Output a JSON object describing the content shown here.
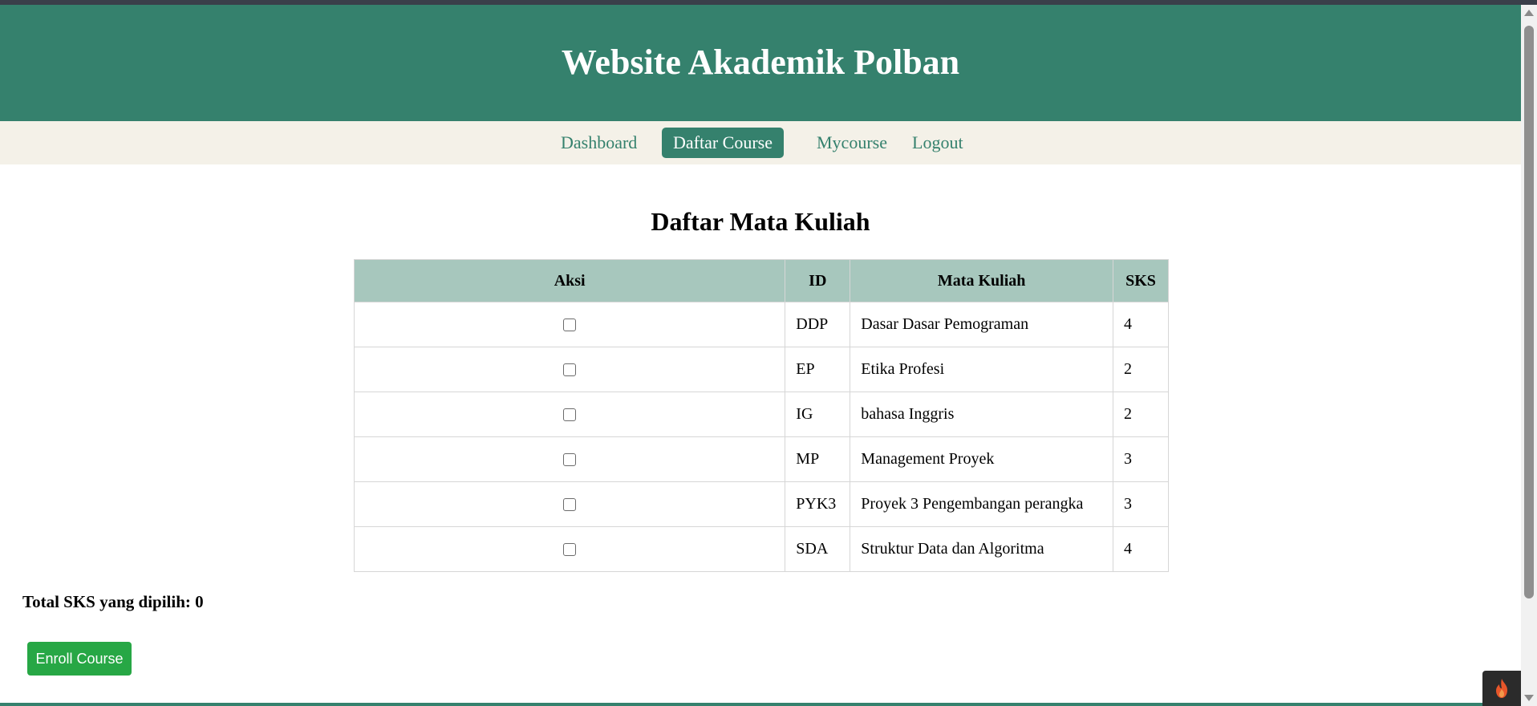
{
  "header": {
    "title": "Website Akademik Polban"
  },
  "nav": {
    "items": [
      {
        "label": "Dashboard",
        "active": false
      },
      {
        "label": "Daftar Course",
        "active": true
      },
      {
        "label": "Mycourse",
        "active": false
      },
      {
        "label": "Logout",
        "active": false
      }
    ]
  },
  "page": {
    "title": "Daftar Mata Kuliah"
  },
  "table": {
    "headers": {
      "aksi": "Aksi",
      "id": "ID",
      "mata_kuliah": "Mata Kuliah",
      "sks": "SKS"
    },
    "rows": [
      {
        "checked": false,
        "id": "DDP",
        "name": "Dasar Dasar Pemograman",
        "sks": "4"
      },
      {
        "checked": false,
        "id": "EP",
        "name": "Etika Profesi",
        "sks": "2"
      },
      {
        "checked": false,
        "id": "IG",
        "name": "bahasa Inggris",
        "sks": "2"
      },
      {
        "checked": false,
        "id": "MP",
        "name": "Management Proyek",
        "sks": "3"
      },
      {
        "checked": false,
        "id": "PYK3",
        "name": "Proyek 3 Pengembangan perangka",
        "sks": "3"
      },
      {
        "checked": false,
        "id": "SDA",
        "name": "Struktur Data dan Algoritma",
        "sks": "4"
      }
    ]
  },
  "total": {
    "label": "Total SKS yang dipilih:",
    "value": "0"
  },
  "enroll_button": {
    "label": "Enroll Course"
  },
  "colors": {
    "primary": "#35816d",
    "nav_bg": "#f4f1e8",
    "table_header": "#a7c7bd",
    "button": "#27a745"
  },
  "icons": {
    "corner_widget": "flame-icon"
  }
}
